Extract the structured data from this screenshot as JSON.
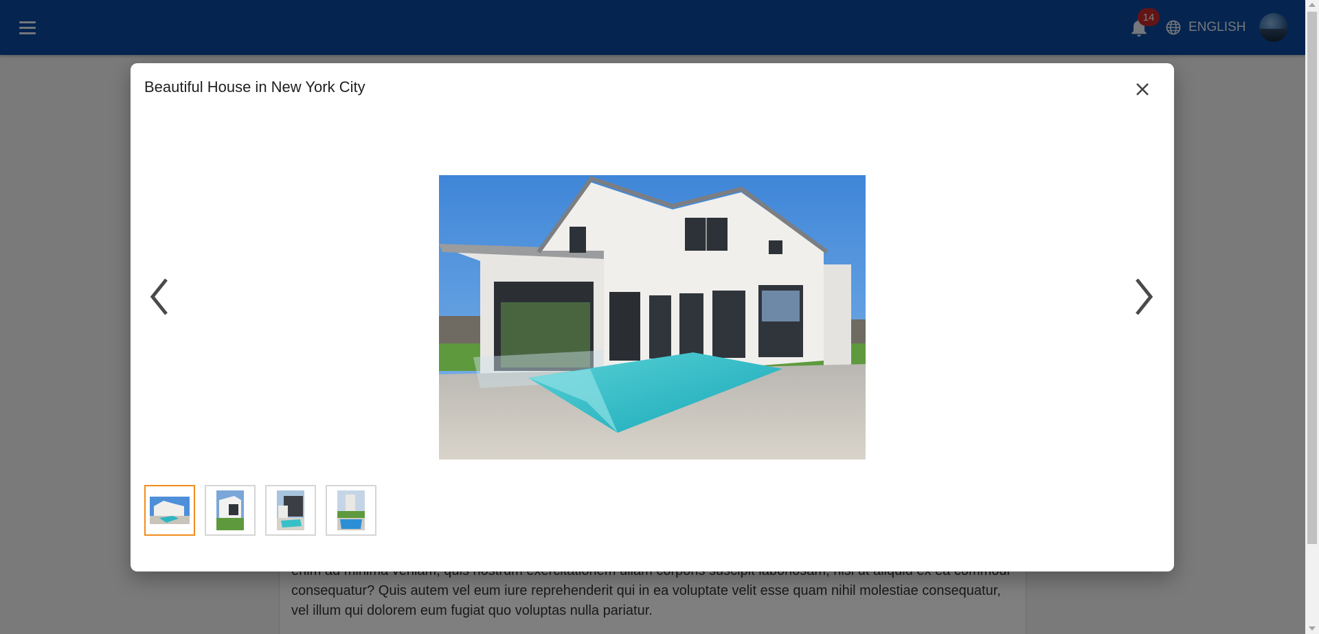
{
  "header": {
    "notification_count": "14",
    "language": "ENGLISH",
    "icons": {
      "menu": "menu-icon",
      "notifications": "bell-icon",
      "language": "globe-icon",
      "avatar": "user-avatar"
    }
  },
  "background_page": {
    "text": "enim ad minima veniam, quis nostrum exercitationem ullam corporis suscipit laboriosam, nisi ut aliquid ex ea commodi consequatur? Quis autem vel eum iure reprehenderit qui in ea voluptate velit esse quam nihil molestiae consequatur, vel illum qui dolorem eum fugiat quo voluptas nulla pariatur."
  },
  "modal": {
    "title": "Beautiful House in New York City",
    "icons": {
      "close": "close-icon",
      "previous": "chevron-left-icon",
      "next": "chevron-right-icon"
    },
    "selected_thumbnail": 1,
    "thumbnails": [
      {
        "name": "house-pool-photo-1"
      },
      {
        "name": "house-lawn-photo-2"
      },
      {
        "name": "house-pool-photo-3"
      },
      {
        "name": "house-pool-photo-4"
      }
    ]
  },
  "colors": {
    "appbar": "#0b4aa0",
    "badge": "#c62828",
    "thumbnail_active_border": "#f08c1a",
    "overlay": "rgba(0,0,0,0.5)"
  }
}
